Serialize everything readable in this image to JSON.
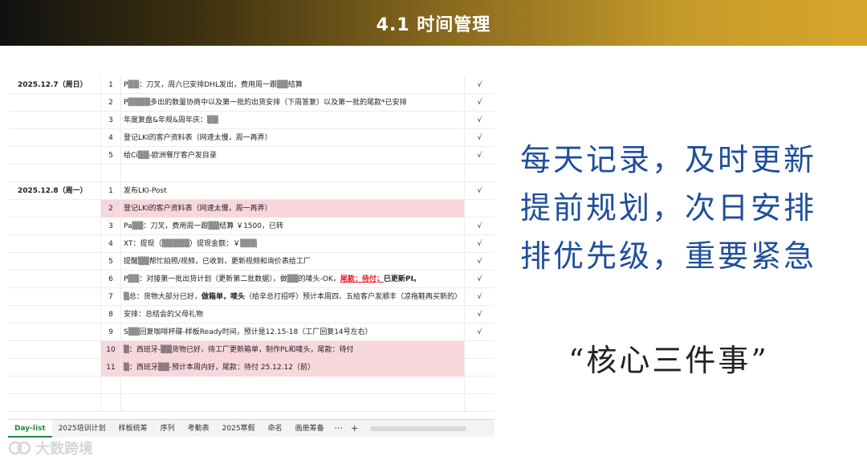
{
  "header": {
    "title": "4.1  时间管理"
  },
  "sheet": {
    "rows": [
      {
        "date": "2025.12.7（周日）",
        "num": "1",
        "task": "P▒▒：刀叉，周六已安排DHL发出，费用周一跟▒▒结算",
        "check": "√",
        "pink": false
      },
      {
        "date": "",
        "num": "2",
        "task": "P▒▒▒▒多出的数量协商中以及第一批的出货安排（下周答复）以及第一批的尾款*已安排",
        "check": "√",
        "pink": false
      },
      {
        "date": "",
        "num": "3",
        "task": "年度复盘&年规&周年庆：▒▒",
        "check": "√",
        "pink": false
      },
      {
        "date": "",
        "num": "4",
        "task": "登记LKI的客户资料表（网速太慢，周一再弄）",
        "check": "√",
        "pink": false
      },
      {
        "date": "",
        "num": "5",
        "task": "给Ci▒▒-欧洲餐厅客户发目录",
        "check": "√",
        "pink": false
      },
      {
        "date": "",
        "num": "",
        "task": "",
        "check": "",
        "pink": false
      },
      {
        "date": "2025.12.8（周一）",
        "num": "1",
        "task": "发布LKI-Post",
        "check": "√",
        "pink": false
      },
      {
        "date": "",
        "num": "2",
        "task": "登记LKI的客户资料表（网速太慢，周一再弄）",
        "check": "",
        "pink": true
      },
      {
        "date": "",
        "num": "3",
        "task": "Pa▒▒：刀叉，费用周一跟▒▒结算 ￥1500，已转",
        "check": "√",
        "pink": false
      },
      {
        "date": "",
        "num": "4",
        "task": "XT：提现（▒▒▒▒▒）提现金额：￥▒▒▒",
        "check": "√",
        "pink": false
      },
      {
        "date": "",
        "num": "5",
        "task": "提醒▒▒帮忙拍照/视频，已收到，更新视频和询价表给工厂",
        "check": "√",
        "pink": false
      },
      {
        "date": "",
        "num": "6",
        "task_parts": [
          "P▒▒：对接第一批出货计划（更新第二批数据），做▒▒的唛头-OK，",
          "尾款：待付；",
          "已更新PI。"
        ],
        "check": "√",
        "pink": false
      },
      {
        "date": "",
        "num": "7",
        "task_parts": [
          "▒总：货物大部分已好，",
          "做箱单，唛头",
          "（给辛总打招呼）预计本周四、五给客户发顺丰（凉拖鞋再买新的）"
        ],
        "check": "√",
        "pink": false
      },
      {
        "date": "",
        "num": "8",
        "task": "安排：总结会的父母礼物",
        "check": "√",
        "pink": false
      },
      {
        "date": "",
        "num": "9",
        "task": "S▒▒回复咖啡杯碟-样板Ready时间，预计是12.15-18（工厂回复14号左右）",
        "check": "√",
        "pink": false
      },
      {
        "date": "",
        "num": "10",
        "task": "▒：西班牙-▒▒货物已好，待工厂更新箱单，制作PL和唛头，尾款：待付",
        "check": "",
        "pink": true
      },
      {
        "date": "",
        "num": "11",
        "task": "▒：西班牙▒▒-预计本周内好，尾款：待付 25.12.12（前）",
        "check": "",
        "pink": true
      },
      {
        "date": "",
        "num": "",
        "task": "",
        "check": "",
        "pink": false
      },
      {
        "date": "",
        "num": "",
        "task": "",
        "check": "",
        "pink": false
      }
    ],
    "tabs": [
      "Day-list",
      "2025培训计划",
      "样板统筹",
      "序列",
      "考勤表",
      "2025寒假",
      "命名",
      "画册筹备"
    ],
    "more": "···",
    "add": "+"
  },
  "right": {
    "lines": [
      "每天记录，及时更新",
      "提前规划，次日安排",
      "排优先级，重要紧急"
    ],
    "quote": "“核心三件事”"
  },
  "watermark": {
    "text": "大数跨境"
  },
  "colors": {
    "accent_blue": "#1e4f9c",
    "pink_row": "#f8d7dc",
    "red_text": "#e01b24",
    "tab_green": "#1f8a3d"
  }
}
